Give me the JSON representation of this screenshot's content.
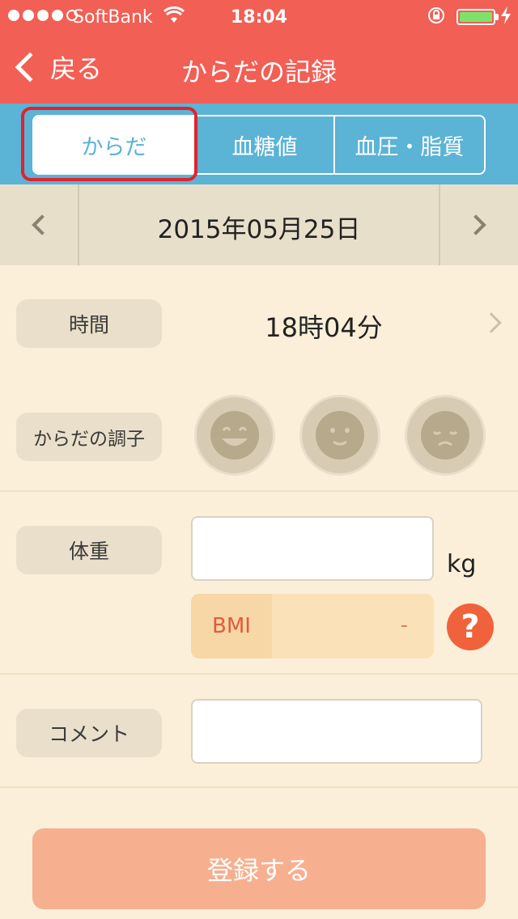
{
  "status_bar": {
    "carrier": "SoftBank",
    "time": "18:04"
  },
  "nav": {
    "back_label": "戻る",
    "title": "からだの記録"
  },
  "tabs": [
    {
      "label": "からだ",
      "active": true
    },
    {
      "label": "血糖値",
      "active": false
    },
    {
      "label": "血圧・脂質",
      "active": false
    }
  ],
  "date_bar": {
    "date": "2015年05月25日"
  },
  "time_row": {
    "label": "時間",
    "value": "18時04分"
  },
  "condition_row": {
    "label": "からだの調子",
    "options": [
      "happy-face-icon",
      "neutral-face-icon",
      "sad-face-icon"
    ]
  },
  "weight_row": {
    "label": "体重",
    "value": "",
    "unit": "kg",
    "bmi_label": "BMI",
    "bmi_value": "-",
    "help_label": "?"
  },
  "comment_row": {
    "label": "コメント",
    "value": ""
  },
  "submit": {
    "label": "登録する"
  },
  "colors": {
    "header": "#f25f54",
    "tab_bar": "#5bb3d6",
    "background": "#fcefd9",
    "submit_button": "#f6b090",
    "highlight": "#e0232c"
  }
}
